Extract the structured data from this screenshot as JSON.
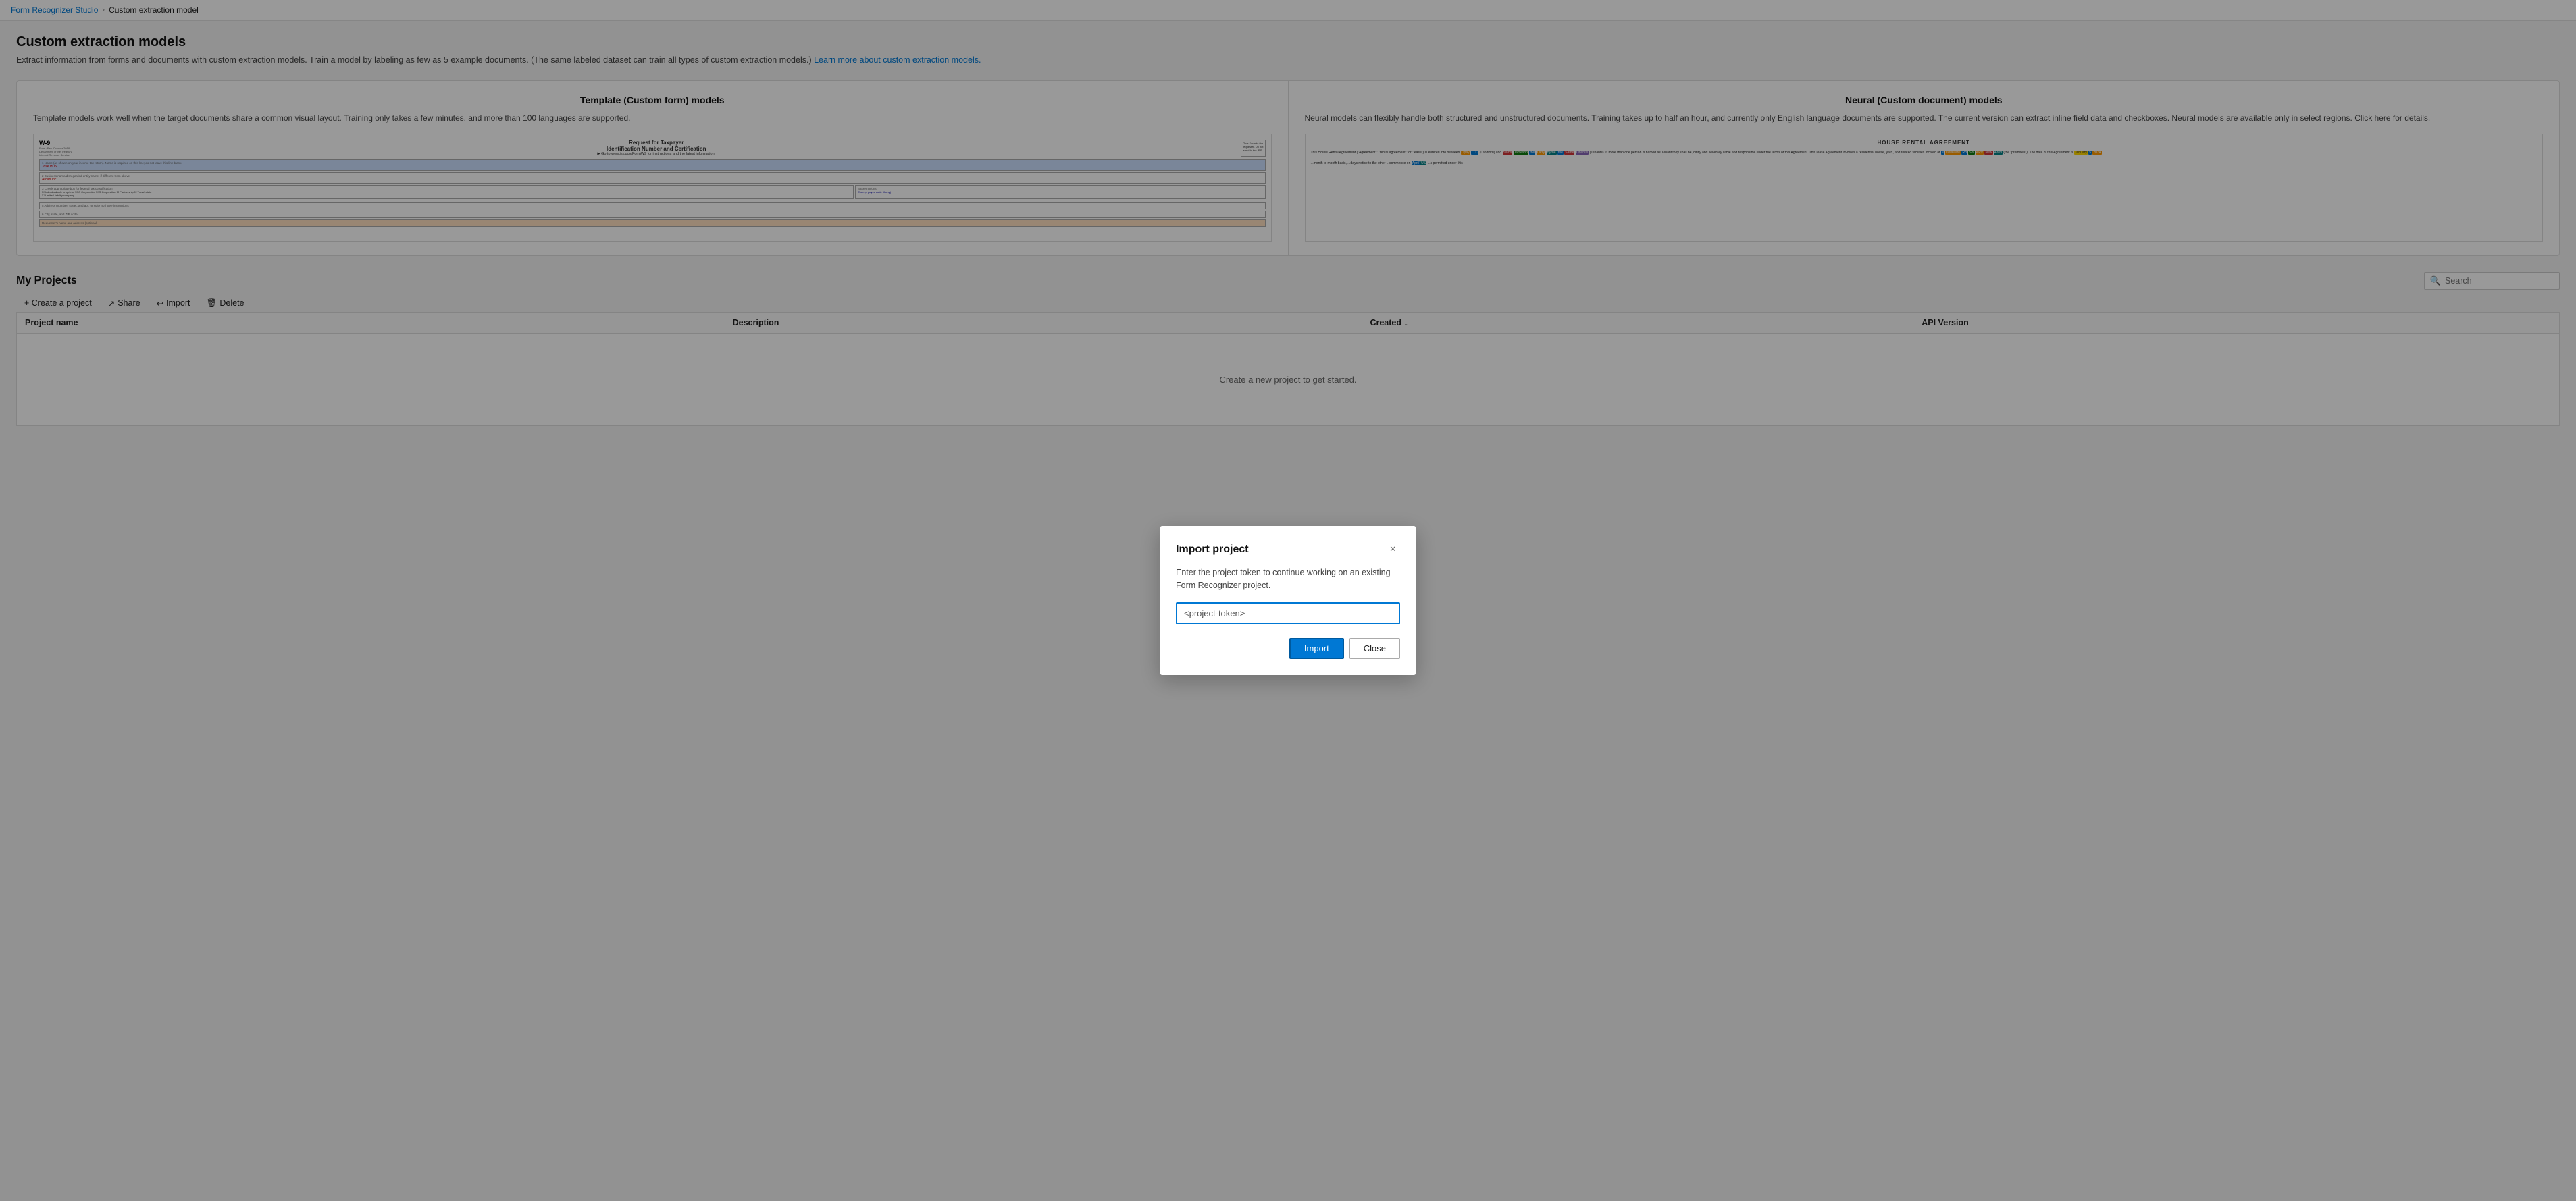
{
  "breadcrumb": {
    "home": "Form Recognizer Studio",
    "separator": "›",
    "current": "Custom extraction model"
  },
  "page": {
    "title": "Custom extraction models",
    "description": "Extract information from forms and documents with custom extraction models. Train a model by labeling as few as 5 example documents. (The same labeled dataset can train all types of custom extraction models.)",
    "learn_more_text": "Learn more about custom extraction models.",
    "learn_more_href": "#"
  },
  "template_model": {
    "title": "Template (Custom form) models",
    "description": "Template models work well when the target documents share a common visual layout. Training only takes a few minutes, and more than 100 languages are supported."
  },
  "neural_model": {
    "title": "Neural (Custom document) models",
    "description": "Neural models can flexibly handle both structured and unstructured documents. Training takes up to half an hour, and currently only English language documents are supported. The current version can extract inline field data and checkboxes. Neural models are available only in select regions.",
    "click_here_text": "Click here",
    "click_here_href": "#",
    "click_here_suffix": "for details."
  },
  "projects": {
    "title": "My Projects",
    "actions": {
      "create": "+ Create a project",
      "share": "Share",
      "import": "Import",
      "delete": "Delete"
    },
    "search_placeholder": "Search",
    "table": {
      "columns": [
        "Project name",
        "Description",
        "Created ↓",
        "API Version"
      ],
      "rows": []
    },
    "empty_state": "Create a new project to get started."
  },
  "modal": {
    "title": "Import project",
    "close_label": "×",
    "description": "Enter the project token to continue working on an existing Form Recognizer project.",
    "input_placeholder": "<project-token>",
    "input_value": "<project-token>",
    "buttons": {
      "import": "Import",
      "close": "Close"
    }
  }
}
